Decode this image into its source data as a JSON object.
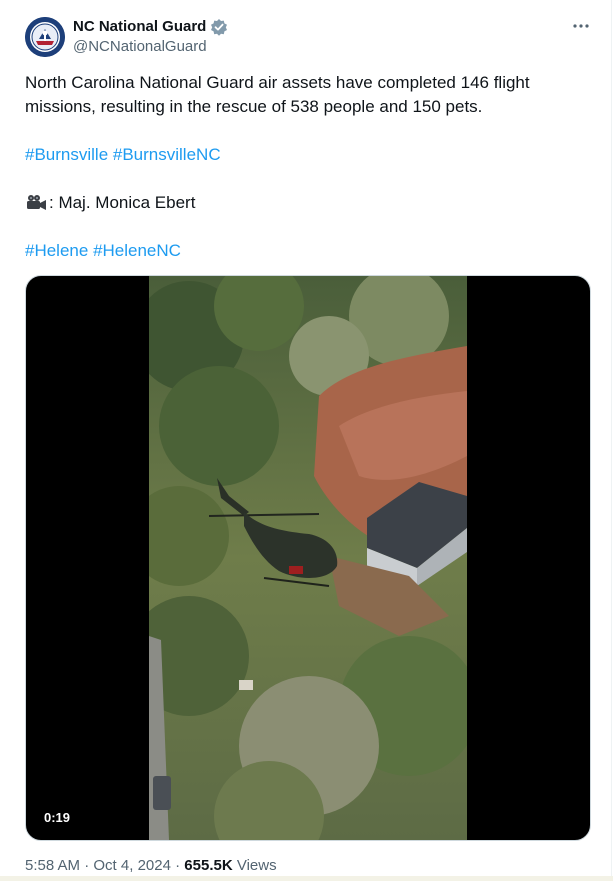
{
  "author": {
    "display_name": "NC National Guard",
    "handle": "@NCNationalGuard",
    "verified": true
  },
  "icons": {
    "avatar": "nc-national-guard-seal-icon",
    "verified": "verified-badge-icon",
    "more": "more-options-icon",
    "camera": "movie-camera-icon"
  },
  "post": {
    "text": "North Carolina National Guard air assets have completed 146 flight missions, resulting in the rescue of 538 people and 150 pets.",
    "hashtags_1": [
      "#Burnsville",
      "#BurnsvilleNC"
    ],
    "credit": ": Maj. Monica Ebert",
    "hashtags_2": [
      "#Helene",
      "#HeleneNC"
    ]
  },
  "media": {
    "type": "video",
    "duration": "0:19"
  },
  "meta": {
    "time": "5:58 AM",
    "separator": " · ",
    "date": "Oct 4, 2024",
    "views_count": "655.5K",
    "views_label": "Views"
  },
  "colors": {
    "link": "#1d9bf0",
    "secondary_text": "#536471",
    "verified": "#829aab"
  }
}
